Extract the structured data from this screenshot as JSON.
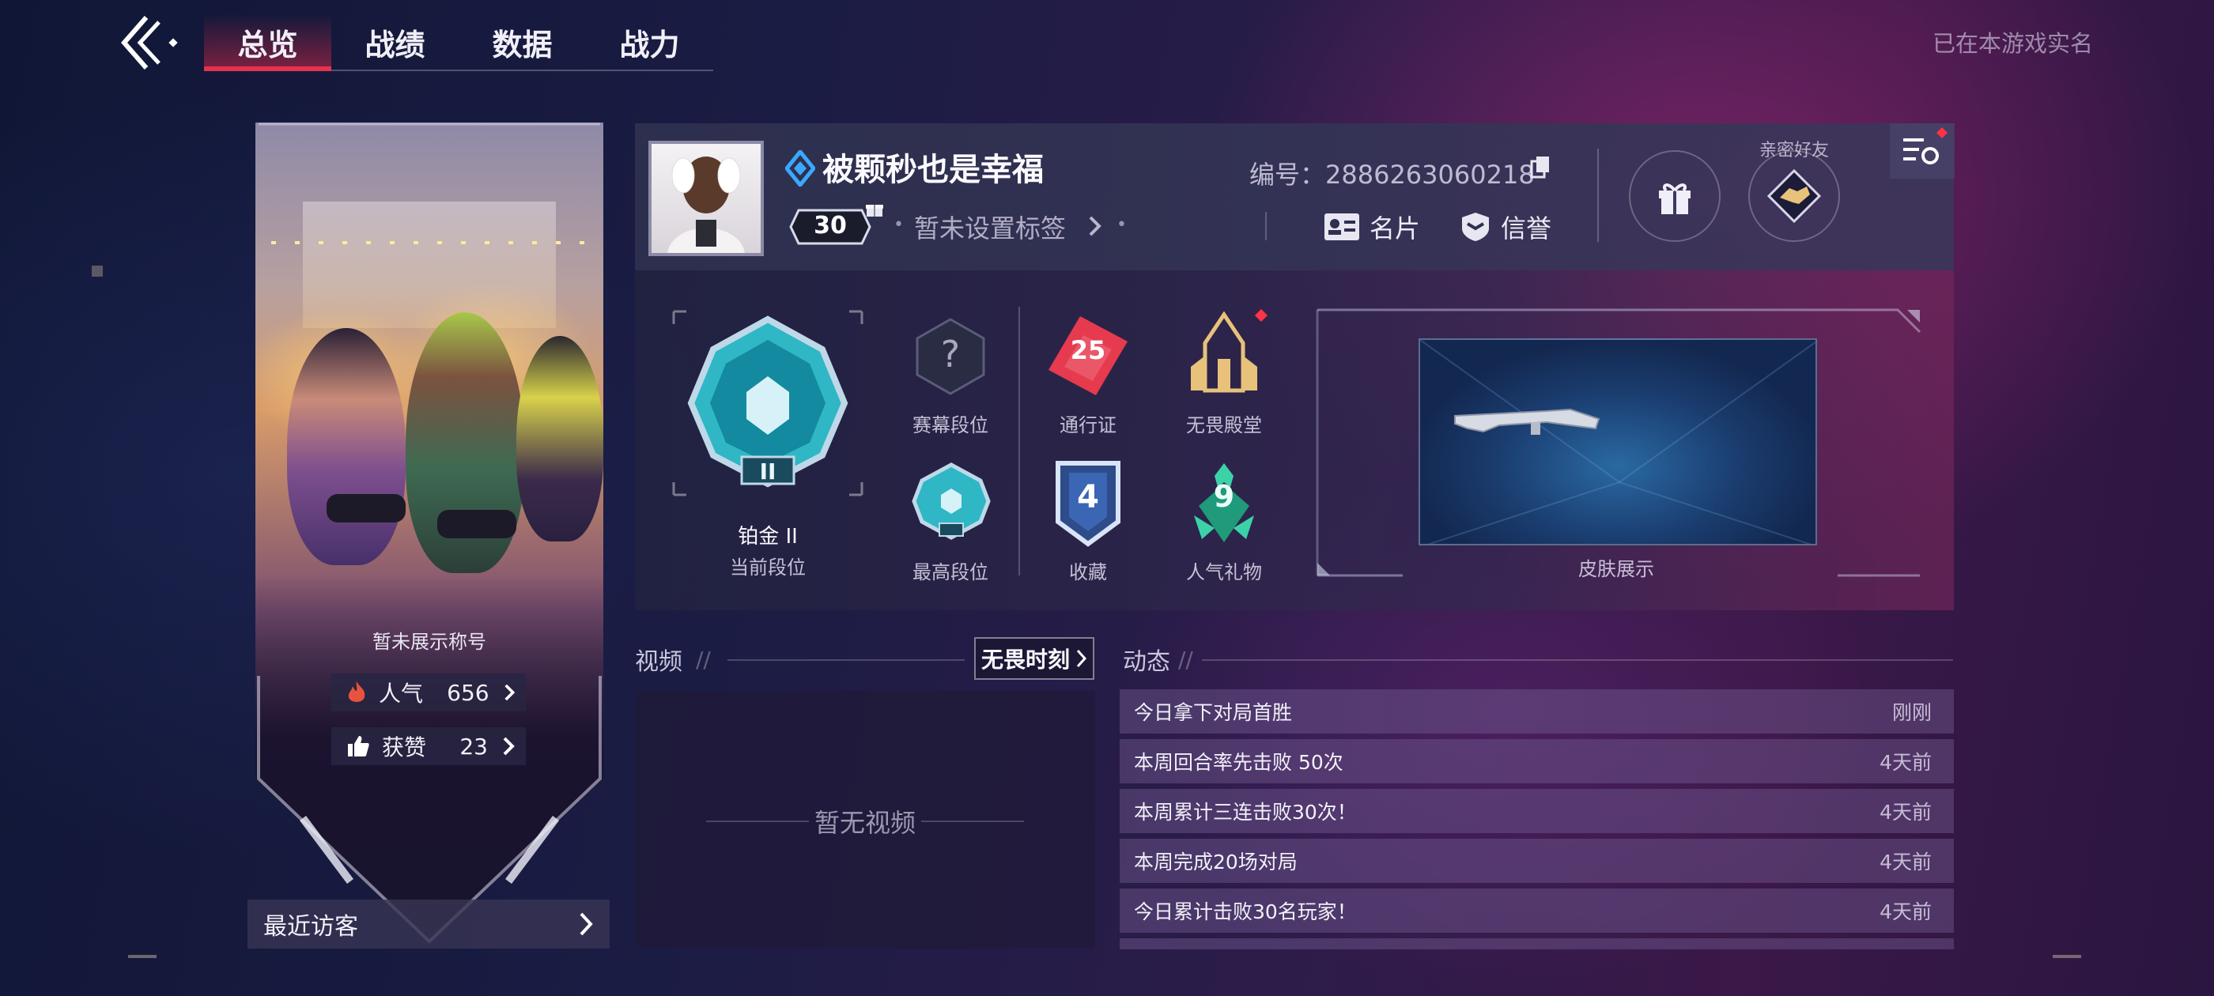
{
  "nav": {
    "tabs": [
      {
        "label": "总览"
      },
      {
        "label": "战绩"
      },
      {
        "label": "数据"
      },
      {
        "label": "战力"
      }
    ],
    "realname_text": "已在本游戏实名"
  },
  "hero": {
    "title_text": "暂未展示称号",
    "popularity": {
      "label": "人气",
      "value": "656"
    },
    "likes": {
      "label": "获赞",
      "value": "23"
    },
    "recent_visitors": "最近访客"
  },
  "profile": {
    "nickname": "被颗秒也是幸福",
    "level": "30",
    "tag": "暂未设置标签",
    "uid_text": "编号：2886263060218",
    "card_label": "名片",
    "credit_label": "信誉",
    "friend_label": "亲密好友"
  },
  "rank": {
    "current_name": "铂金 II",
    "current_caption": "当前段位",
    "current_roman": "II",
    "season_caption": "赛幕段位",
    "highest_caption": "最高段位",
    "pass_caption": "通行证",
    "pass_value": "25",
    "hall_caption": "无畏殿堂",
    "collection_caption": "收藏",
    "collection_value": "4",
    "gift_caption": "人气礼物",
    "gift_value": "9",
    "skin_caption": "皮肤展示"
  },
  "video": {
    "title": "视频",
    "button": "无畏时刻",
    "empty": "暂无视频"
  },
  "feed": {
    "title": "动态",
    "items": [
      {
        "text": "今日拿下对局首胜",
        "time": "刚刚"
      },
      {
        "text": "本周回合率先击败 50次",
        "time": "4天前"
      },
      {
        "text": "本周累计三连击败30次！",
        "time": "4天前"
      },
      {
        "text": "本周完成20场对局",
        "time": "4天前"
      },
      {
        "text": "今日累计击败30名玩家！",
        "time": "4天前"
      }
    ]
  },
  "colors": {
    "accent_red": "#e4324f",
    "cyan_badge": "#3fd0d8",
    "gold": "#e8c27a"
  },
  "icons": [
    "back-icon",
    "fire-icon",
    "thumb-up-icon",
    "chevron-right-icon",
    "diamond-rank-icon",
    "copy-icon",
    "id-card-icon",
    "shield-icon",
    "gift-icon",
    "handshake-icon",
    "settings-list-icon",
    "question-icon",
    "ticket-icon",
    "temple-icon",
    "collection-badge-icon",
    "gift-badge-icon",
    "rifle-icon"
  ]
}
